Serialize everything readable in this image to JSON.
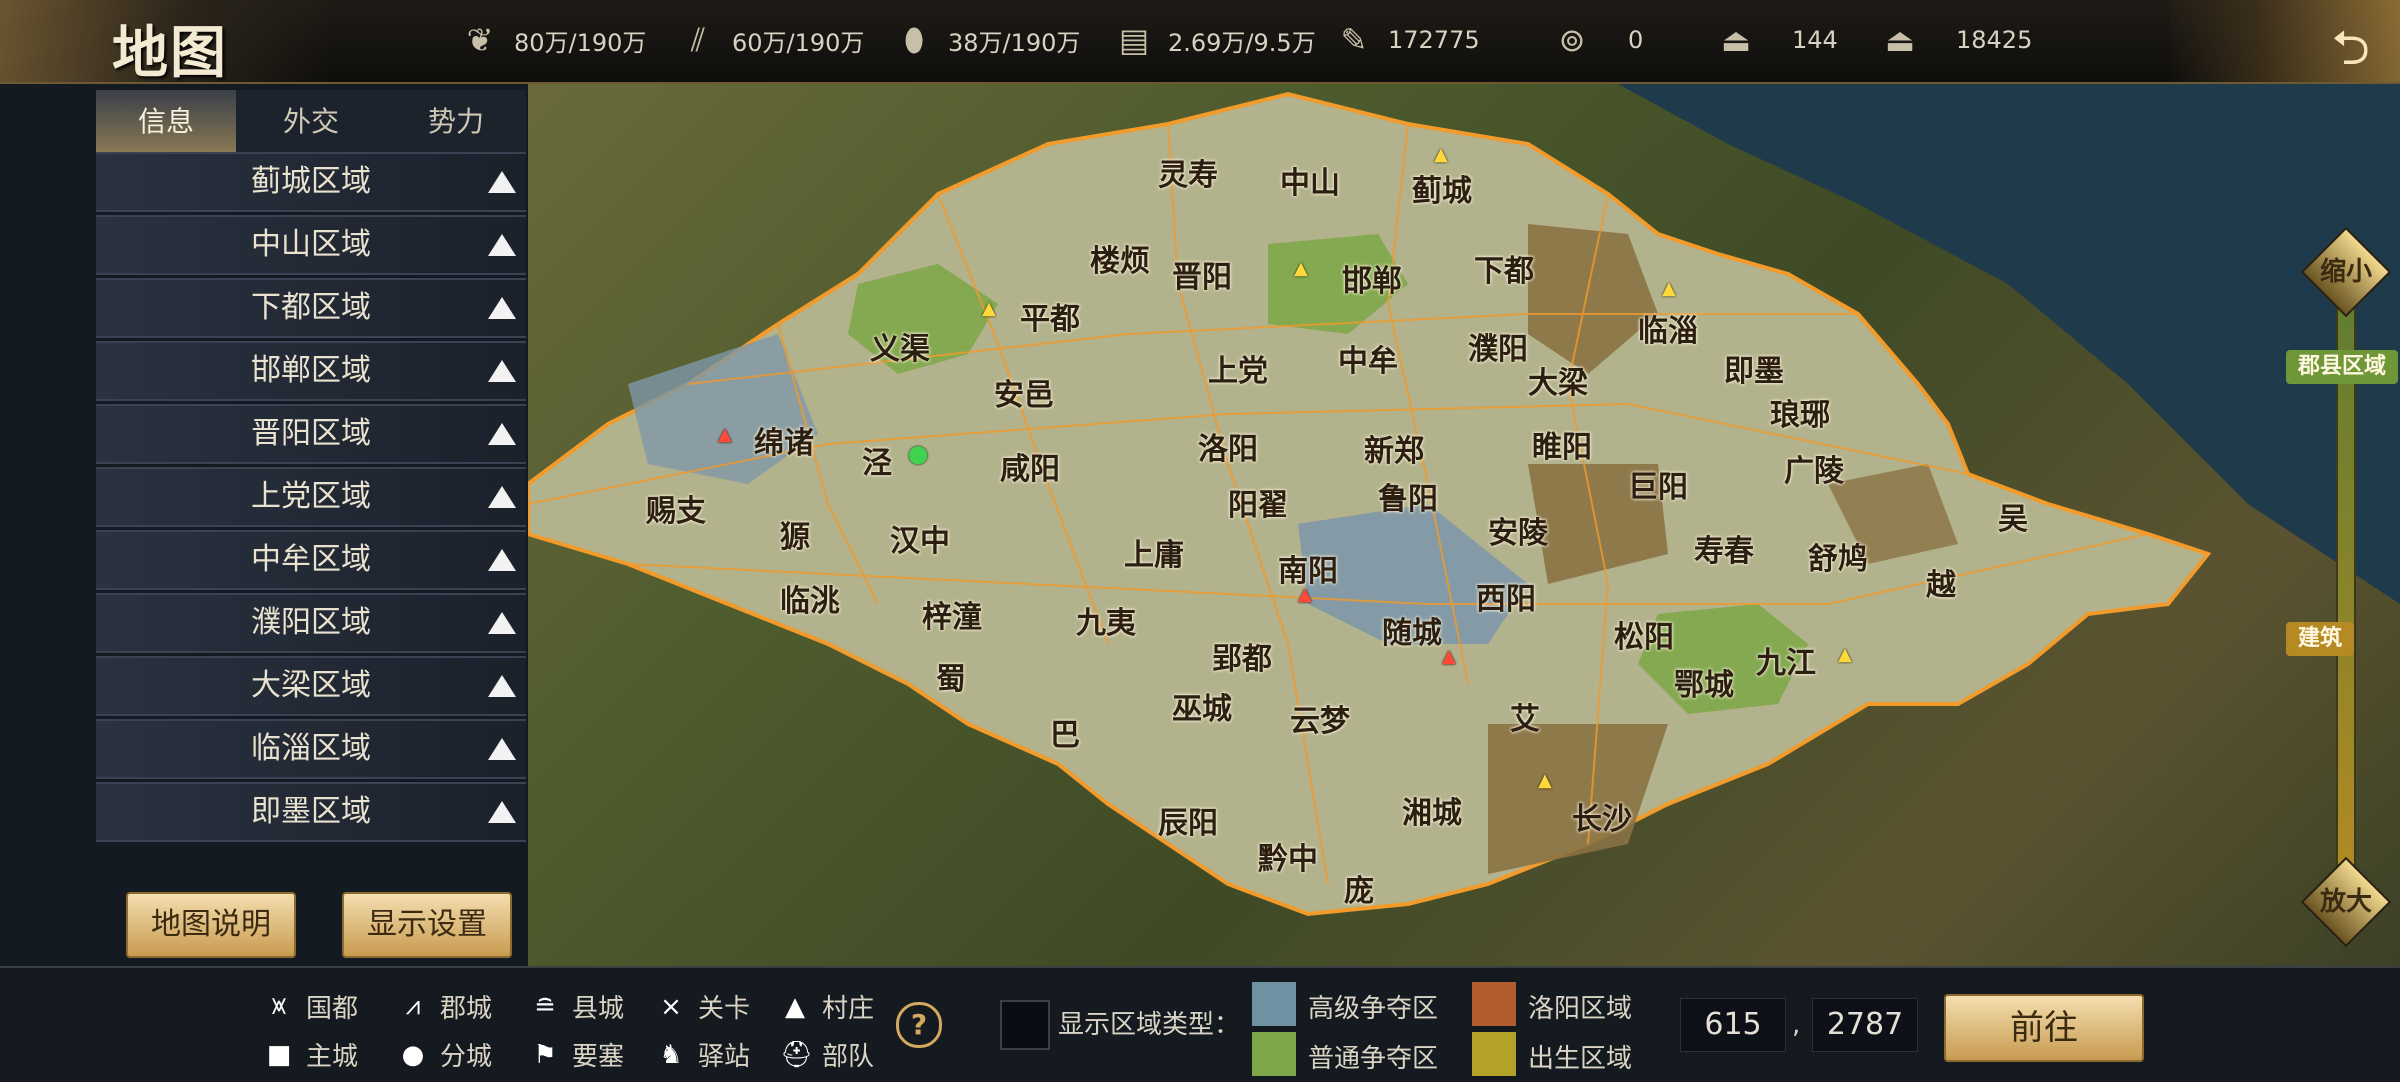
{
  "header": {
    "title": "地图",
    "resources": [
      {
        "icon": "grain-icon",
        "value": "80万/190万"
      },
      {
        "icon": "wood-icon",
        "value": "60万/190万"
      },
      {
        "icon": "stone-icon",
        "value": "38万/190万"
      },
      {
        "icon": "iron-icon",
        "value": "2.69万/9.5万"
      },
      {
        "icon": "decree-icon",
        "value": "172775"
      },
      {
        "icon": "copper-coin-icon",
        "value": "0"
      },
      {
        "icon": "gold-ingot-icon",
        "value": "144"
      },
      {
        "icon": "silver-ingot-icon",
        "value": "18425"
      }
    ]
  },
  "sidebar": {
    "tabs": [
      "信息",
      "外交",
      "势力"
    ],
    "active_tab": "信息",
    "regions": [
      "蓟城区域",
      "中山区域",
      "下都区域",
      "邯郸区域",
      "晋阳区域",
      "上党区域",
      "中牟区域",
      "濮阳区域",
      "大梁区域",
      "临淄区域",
      "即墨区域"
    ],
    "buttons": {
      "map_help": "地图说明",
      "display_settings": "显示设置"
    }
  },
  "map": {
    "cities": [
      {
        "name": "灵寿"
      },
      {
        "name": "中山"
      },
      {
        "name": "蓟城"
      },
      {
        "name": "楼烦"
      },
      {
        "name": "晋阳"
      },
      {
        "name": "邯郸"
      },
      {
        "name": "下都"
      },
      {
        "name": "平都"
      },
      {
        "name": "义渠"
      },
      {
        "name": "上党"
      },
      {
        "name": "中牟"
      },
      {
        "name": "濮阳"
      },
      {
        "name": "临淄"
      },
      {
        "name": "即墨"
      },
      {
        "name": "大梁"
      },
      {
        "name": "安邑"
      },
      {
        "name": "琅琊"
      },
      {
        "name": "绵诸"
      },
      {
        "name": "泾"
      },
      {
        "name": "咸阳"
      },
      {
        "name": "洛阳"
      },
      {
        "name": "新郑"
      },
      {
        "name": "睢阳"
      },
      {
        "name": "巨阳"
      },
      {
        "name": "广陵"
      },
      {
        "name": "赐支"
      },
      {
        "name": "獂"
      },
      {
        "name": "汉中"
      },
      {
        "name": "阳翟"
      },
      {
        "name": "鲁阳"
      },
      {
        "name": "安陵"
      },
      {
        "name": "吴"
      },
      {
        "name": "上庸"
      },
      {
        "name": "南阳"
      },
      {
        "name": "寿春"
      },
      {
        "name": "舒鸠"
      },
      {
        "name": "临洮"
      },
      {
        "name": "梓潼"
      },
      {
        "name": "九夷"
      },
      {
        "name": "西阳"
      },
      {
        "name": "越"
      },
      {
        "name": "随城"
      },
      {
        "name": "松阳"
      },
      {
        "name": "九江"
      },
      {
        "name": "蜀"
      },
      {
        "name": "郢都"
      },
      {
        "name": "鄂城"
      },
      {
        "name": "巫城"
      },
      {
        "name": "云梦"
      },
      {
        "name": "艾"
      },
      {
        "name": "巴"
      },
      {
        "name": "湘城"
      },
      {
        "name": "长沙"
      },
      {
        "name": "辰阳"
      },
      {
        "name": "黔中"
      },
      {
        "name": "庞"
      }
    ]
  },
  "zoom_slider": {
    "top_label": "缩小",
    "bottom_label": "放大",
    "flag_top": "郡县区域",
    "flag_mid": "建筑"
  },
  "legend": {
    "items": [
      {
        "icon": "capital-icon",
        "label": "国都"
      },
      {
        "icon": "prefecture-icon",
        "label": "郡城"
      },
      {
        "icon": "county-icon",
        "label": "县城"
      },
      {
        "icon": "pass-icon",
        "label": "关卡"
      },
      {
        "icon": "village-icon",
        "label": "村庄"
      },
      {
        "icon": "main-city-icon",
        "label": "主城"
      },
      {
        "icon": "branch-city-icon",
        "label": "分城"
      },
      {
        "icon": "fortress-icon",
        "label": "要塞"
      },
      {
        "icon": "station-icon",
        "label": "驿站"
      },
      {
        "icon": "troop-icon",
        "label": "部队"
      }
    ],
    "region_type_label": "显示区域类型：",
    "region_types": [
      {
        "label": "高级争夺区",
        "color": "#6d93a3"
      },
      {
        "label": "普通争夺区",
        "color": "#7fa74a"
      },
      {
        "label": "洛阳区域",
        "color": "#b35c2d"
      },
      {
        "label": "出生区域",
        "color": "#b3a12a"
      }
    ]
  },
  "coordinates": {
    "x": "615",
    "y": "2787",
    "separator": ",",
    "go_label": "前往"
  },
  "colors": {
    "accent": "#e7cb7d",
    "panel": "#1d232d",
    "map_border": "#f29a2a"
  }
}
